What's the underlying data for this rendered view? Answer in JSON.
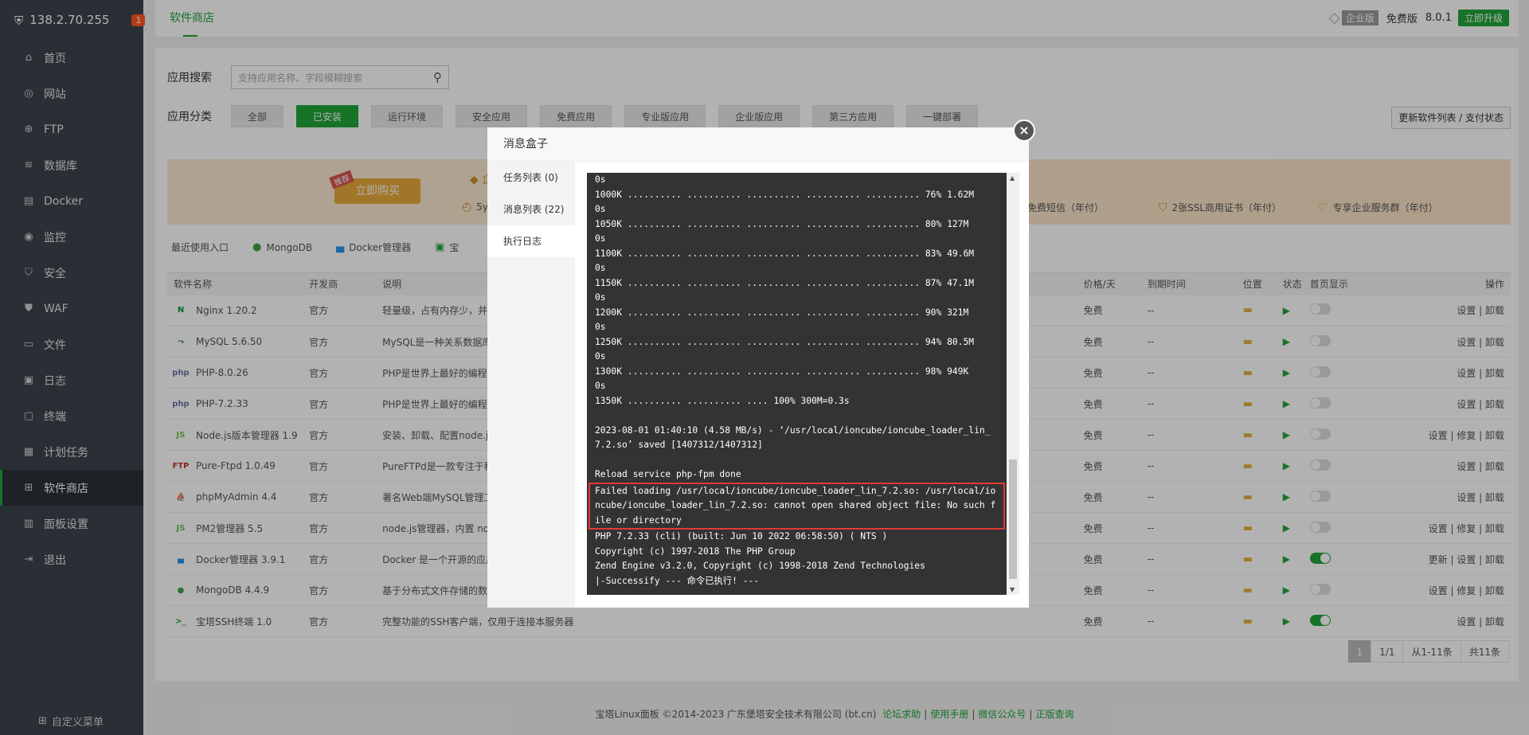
{
  "sidebar": {
    "ip": "138.2.70.255",
    "badge": "1",
    "items": [
      {
        "label": "首页",
        "icon": "home-icon",
        "glyph": "⌂"
      },
      {
        "label": "网站",
        "icon": "globe-icon",
        "glyph": "◎"
      },
      {
        "label": "FTP",
        "icon": "ftp-icon",
        "glyph": "⊕"
      },
      {
        "label": "数据库",
        "icon": "database-icon",
        "glyph": "≋"
      },
      {
        "label": "Docker",
        "icon": "docker-icon",
        "glyph": "▤"
      },
      {
        "label": "监控",
        "icon": "monitor-icon",
        "glyph": "◉"
      },
      {
        "label": "安全",
        "icon": "shield-icon",
        "glyph": "⛉"
      },
      {
        "label": "WAF",
        "icon": "waf-icon",
        "glyph": "⛊"
      },
      {
        "label": "文件",
        "icon": "folder-icon",
        "glyph": "▭"
      },
      {
        "label": "日志",
        "icon": "log-icon",
        "glyph": "▣"
      },
      {
        "label": "终端",
        "icon": "terminal-icon",
        "glyph": "▢"
      },
      {
        "label": "计划任务",
        "icon": "calendar-icon",
        "glyph": "▦"
      },
      {
        "label": "软件商店",
        "icon": "apps-icon",
        "glyph": "⊞"
      },
      {
        "label": "面板设置",
        "icon": "settings-icon",
        "glyph": "▥"
      },
      {
        "label": "退出",
        "icon": "logout-icon",
        "glyph": "⇥"
      }
    ],
    "active_index": 12,
    "custom_menu": "自定义菜单"
  },
  "topbar": {
    "tab": "软件商店",
    "enterprise": "企业版",
    "free": "免费版",
    "version": "8.0.1",
    "upgrade": "立即升级"
  },
  "search": {
    "label": "应用搜索",
    "placeholder": "支持应用名称、字段模糊搜索"
  },
  "categories": {
    "label": "应用分类",
    "items": [
      "全部",
      "已安装",
      "运行环境",
      "安全应用",
      "免费应用",
      "专业版应用",
      "企业版应用",
      "第三方应用",
      "一键部署"
    ],
    "active": 1,
    "update_button": "更新软件列表 / 支付状态"
  },
  "promo": {
    "tag": "推荐",
    "buy": "立即购买",
    "heading": "企",
    "item0": "5y",
    "item1": "免费短信（年付）",
    "item2": "2张SSL商用证书（年付）",
    "item3": "专享企业服务群（年付）"
  },
  "recent": {
    "label": "最近使用入口",
    "items": [
      {
        "name": "MongoDB",
        "icon": "mongodb-icon"
      },
      {
        "name": "Docker管理器",
        "icon": "docker-icon"
      },
      {
        "name": "宝",
        "icon": "terminal-icon"
      }
    ]
  },
  "table": {
    "headers": [
      "软件名称",
      "开发商",
      "说明",
      "价格/天",
      "到期时间",
      "位置",
      "状态",
      "首页显示",
      "操作"
    ],
    "rows": [
      {
        "name": "Nginx 1.20.2",
        "dev": "官方",
        "desc": "轻量级，占有内存少，并",
        "price": "免费",
        "expire": "--",
        "toggle": false,
        "ops": "设置 | 卸载",
        "icon": "nginx-icon",
        "ig": "N",
        "ic": "#009639"
      },
      {
        "name": "MySQL 5.6.50",
        "dev": "官方",
        "desc": "MySQL是一种关系数据库",
        "price": "免费",
        "expire": "--",
        "toggle": false,
        "ops": "设置 | 卸载",
        "icon": "mysql-icon",
        "ig": "⤳",
        "ic": "#4479a1"
      },
      {
        "name": "PHP-8.0.26",
        "dev": "官方",
        "desc": "PHP是世界上最好的编程",
        "price": "免费",
        "expire": "--",
        "toggle": false,
        "ops": "设置 | 卸载",
        "icon": "php-icon",
        "ig": "php",
        "ic": "#6c78af"
      },
      {
        "name": "PHP-7.2.33",
        "dev": "官方",
        "desc": "PHP是世界上最好的编程",
        "price": "免费",
        "expire": "--",
        "toggle": false,
        "ops": "设置 | 卸载",
        "icon": "php-icon",
        "ig": "php",
        "ic": "#6c78af"
      },
      {
        "name": "Node.js版本管理器 1.9",
        "dev": "官方",
        "desc": "安装、卸载、配置node.j",
        "price": "免费",
        "expire": "--",
        "toggle": false,
        "ops": "设置 | 修复 | 卸载",
        "icon": "nodejs-icon",
        "ig": "JS",
        "ic": "#6cc24a"
      },
      {
        "name": "Pure-Ftpd 1.0.49",
        "dev": "官方",
        "desc": "PureFTPd是一款专注于程",
        "price": "免费",
        "expire": "--",
        "toggle": false,
        "ops": "设置 | 卸载",
        "icon": "ftp-icon",
        "ig": "FTP",
        "ic": "#c0392b"
      },
      {
        "name": "phpMyAdmin 4.4",
        "dev": "官方",
        "desc": "著名Web端MySQL管理工",
        "price": "免费",
        "expire": "--",
        "toggle": false,
        "ops": "设置 | 卸载",
        "icon": "phpmyadmin-icon",
        "ig": "⛵",
        "ic": "#e8a93a"
      },
      {
        "name": "PM2管理器 5.5",
        "dev": "官方",
        "desc": "node.js管理器，内置 no",
        "price": "免费",
        "expire": "--",
        "toggle": false,
        "ops": "设置 | 修复 | 卸载",
        "icon": "pm2-icon",
        "ig": "JS",
        "ic": "#6cc24a"
      },
      {
        "name": "Docker管理器 3.9.1",
        "dev": "官方",
        "desc": "Docker 是一个开源的应用",
        "price": "免费",
        "expire": "--",
        "toggle": true,
        "ops": "更新 | 设置 | 卸载",
        "icon": "docker-icon",
        "ig": "▄",
        "ic": "#2496ed"
      },
      {
        "name": "MongoDB 4.4.9",
        "dev": "官方",
        "desc": "基于分布式文件存储的数",
        "price": "免费",
        "expire": "--",
        "toggle": false,
        "ops": "设置 | 修复 | 卸载",
        "icon": "mongodb-icon",
        "ig": "●",
        "ic": "#47a248"
      },
      {
        "name": "宝塔SSH终端 1.0",
        "dev": "官方",
        "desc": "完整功能的SSH客户端，仅用于连接本服务器",
        "price": "免费",
        "expire": "--",
        "toggle": true,
        "ops": "设置 | 卸载",
        "icon": "terminal-icon",
        "ig": ">_",
        "ic": "#20a53a"
      }
    ]
  },
  "pager": {
    "current": "1",
    "pages": "1/1",
    "range": "从1-11条",
    "total": "共11条"
  },
  "footer": {
    "copyright": "宝塔Linux面板 ©2014-2023 广东堡塔安全技术有限公司 (bt.cn)",
    "links": [
      "论坛求助",
      "使用手册",
      "微信公众号",
      "正版查询"
    ]
  },
  "modal": {
    "title": "消息盒子",
    "tabs": [
      "任务列表 (0)",
      "消息列表 (22)",
      "执行日志"
    ],
    "active_tab": 2,
    "log_before": "0s\n1000K .......... .......... .......... .......... .......... 76% 1.62M\n0s\n1050K .......... .......... .......... .......... .......... 80% 127M\n0s\n1100K .......... .......... .......... .......... .......... 83% 49.6M\n0s\n1150K .......... .......... .......... .......... .......... 87% 47.1M\n0s\n1200K .......... .......... .......... .......... .......... 90% 321M\n0s\n1250K .......... .......... .......... .......... .......... 94% 80.5M\n0s\n1300K .......... .......... .......... .......... .......... 98% 949K\n0s\n1350K .......... .......... .... 100% 300M=0.3s\n\n2023-08-01 01:40:10 (4.58 MB/s) - ‘/usr/local/ioncube/ioncube_loader_lin_7.2.so’ saved [1407312/1407312]\n\nReload service php-fpm done",
    "log_error": "Failed loading /usr/local/ioncube/ioncube_loader_lin_7.2.so: /usr/local/ioncube/ioncube_loader_lin_7.2.so: cannot open shared object file: No such file or directory",
    "log_after": "PHP 7.2.33 (cli) (built: Jun 10 2022 06:58:50) ( NTS )\nCopyright (c) 1997-2018 The PHP Group\nZend Engine v3.2.0, Copyright (c) 1998-2018 Zend Technologies\n|-Successify --- 命令已执行! ---"
  },
  "colors": {
    "accent": "#20a53a",
    "sidebar": "#3c444d",
    "error": "#e53935"
  }
}
